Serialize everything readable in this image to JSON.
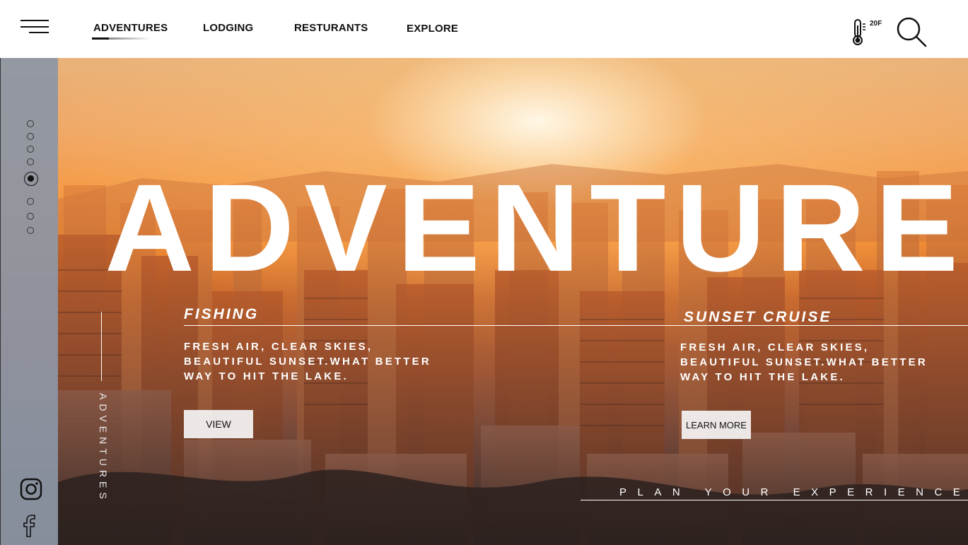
{
  "nav": {
    "links": [
      "ADVENTURES",
      "LODGING",
      "RESTURANTS",
      "EXPLORE"
    ],
    "active_index": 0,
    "temperature": "20F"
  },
  "hero": {
    "title": "ADVENTURE",
    "vertical_label": "ADVENTURES",
    "pagination": {
      "count": 8,
      "active_index": 4
    },
    "cards": [
      {
        "title": "FISHING",
        "text": "FRESH AIR, CLEAR SKIES, BEAUTIFUL SUNSET.WHAT BETTER WAY TO HIT THE LAKE.",
        "button": "VIEW"
      },
      {
        "title": "SUNSET CRUISE",
        "text": "FRESH AIR, CLEAR SKIES, BEAUTIFUL SUNSET.WHAT BETTER WAY TO HIT THE LAKE.",
        "button": "LEARN MORE"
      }
    ],
    "cta": "PLAN YOUR EXPERIENCE"
  },
  "social": [
    "instagram-icon",
    "facebook-icon"
  ],
  "colors": {
    "sunset_orange": "#f08a32",
    "sidebar": "#8c96a5",
    "text_dark": "#111111"
  }
}
